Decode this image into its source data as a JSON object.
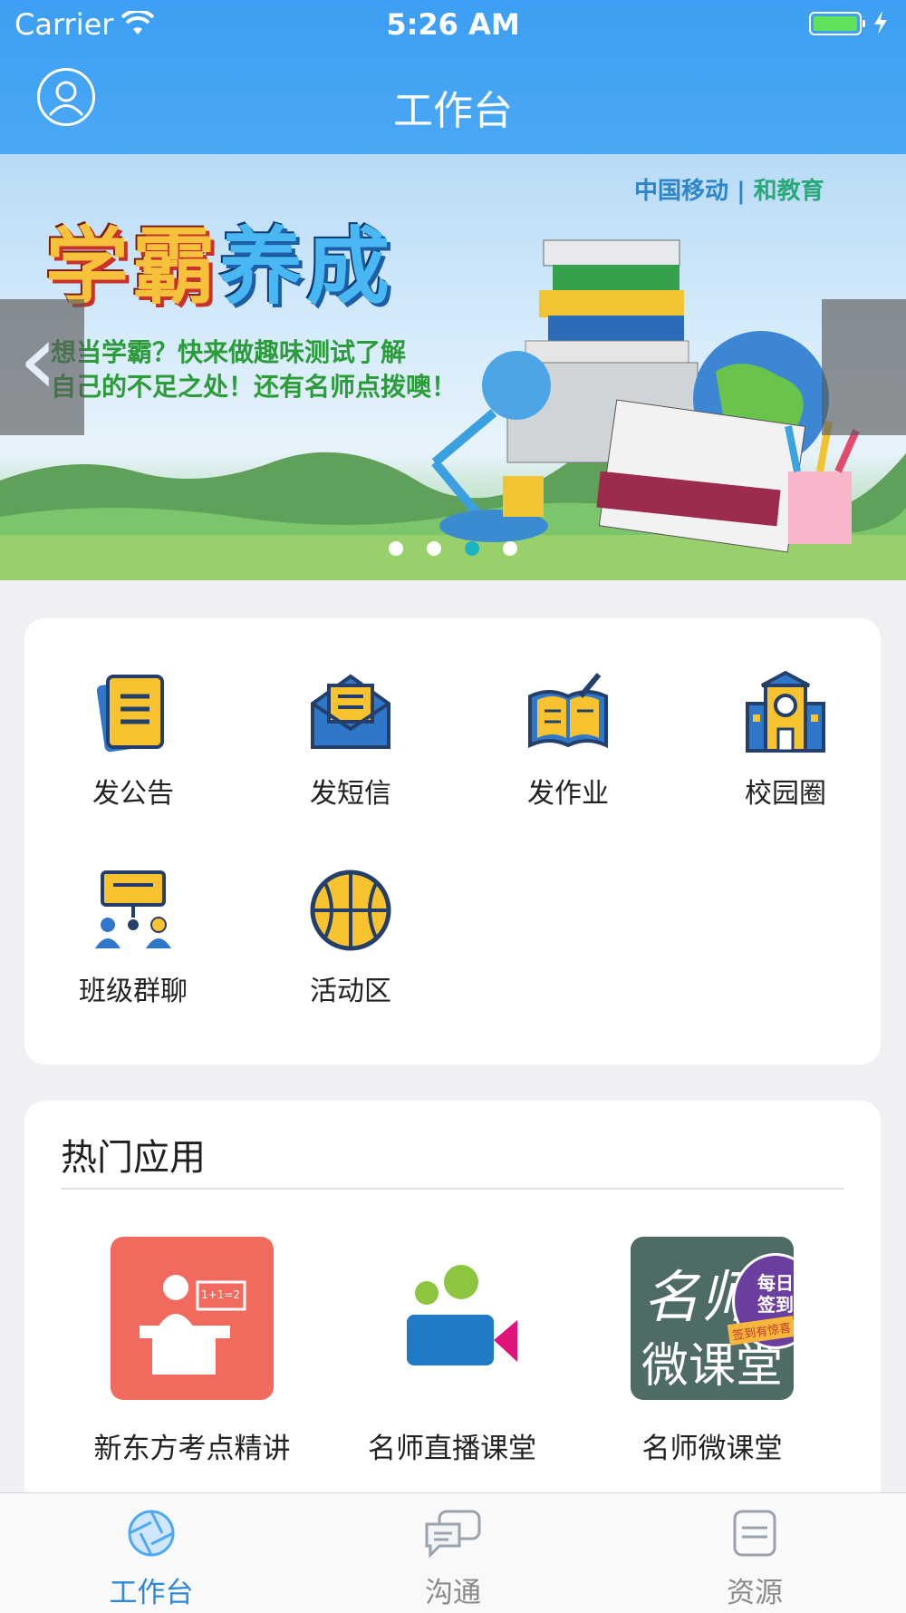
{
  "status_bar": {
    "carrier": "Carrier",
    "time": "5:26 AM"
  },
  "header": {
    "title": "工作台"
  },
  "banner": {
    "logo_left": "中国移动",
    "logo_right": "和教育",
    "title_part1": "学霸",
    "title_part2": "养成",
    "line1": "想当学霸？快来做趣味测试了解",
    "line2": "自己的不足之处！还有名师点拨噢！",
    "active_dot": 3,
    "dot_count": 4
  },
  "quick_actions": [
    {
      "label": "发公告",
      "icon": "notice-icon"
    },
    {
      "label": "发短信",
      "icon": "message-icon"
    },
    {
      "label": "发作业",
      "icon": "homework-icon"
    },
    {
      "label": "校园圈",
      "icon": "campus-icon"
    },
    {
      "label": "班级群聊",
      "icon": "group-chat-icon"
    },
    {
      "label": "活动区",
      "icon": "basketball-icon"
    }
  ],
  "hot_apps": {
    "title": "热门应用",
    "items": [
      {
        "label": "新东方考点精讲",
        "pic_text": "1+1=2"
      },
      {
        "label": "名师直播课堂"
      },
      {
        "label": "名师微课堂",
        "pic_text_1": "名师",
        "pic_text_2": "微课堂",
        "badge_1": "每日",
        "badge_2": "签到",
        "badge_3": "签到有惊喜"
      }
    ]
  },
  "tabbar": [
    {
      "label": "工作台",
      "active": true,
      "icon": "workbench-icon"
    },
    {
      "label": "沟通",
      "active": false,
      "icon": "chat-icon"
    },
    {
      "label": "资源",
      "active": false,
      "icon": "resource-icon"
    }
  ],
  "colors": {
    "header": "#4aa8f5",
    "accent": "#2d89d8",
    "icon_yellow": "#f8c32e",
    "icon_blue": "#2f77c8",
    "icon_navy": "#24406a"
  }
}
